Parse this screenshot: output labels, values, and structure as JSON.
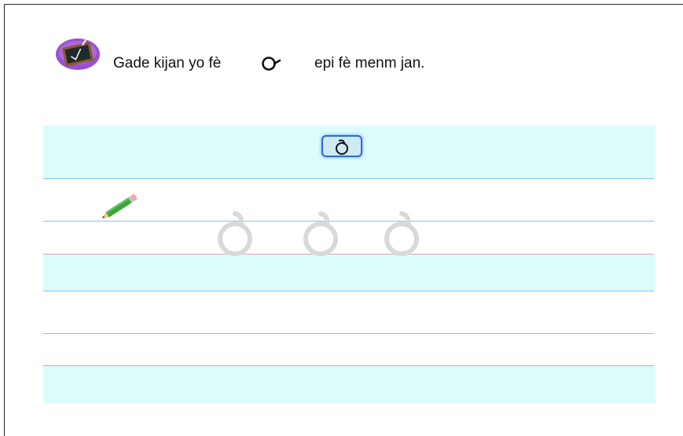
{
  "instruction": {
    "text_before": "Gade kijan yo fè",
    "text_after": "epi fè menm jan.",
    "icon": "chalkboard-check-icon",
    "example_glyph": "loop-stroke-glyph"
  },
  "worksheet": {
    "model_glyph_button": "model-letter-glyph",
    "pencil_icon": "pencil-icon",
    "trace_glyphs": [
      "trace-letter-glyph",
      "trace-letter-glyph",
      "trace-letter-glyph"
    ],
    "colors": {
      "band": "#dcfbfb",
      "guide_line_blue": "#7fc4ee",
      "guide_line_pink": "#e79abb",
      "trace_glyph": "#d9d9d9",
      "button_border": "#2a6bd8"
    }
  }
}
